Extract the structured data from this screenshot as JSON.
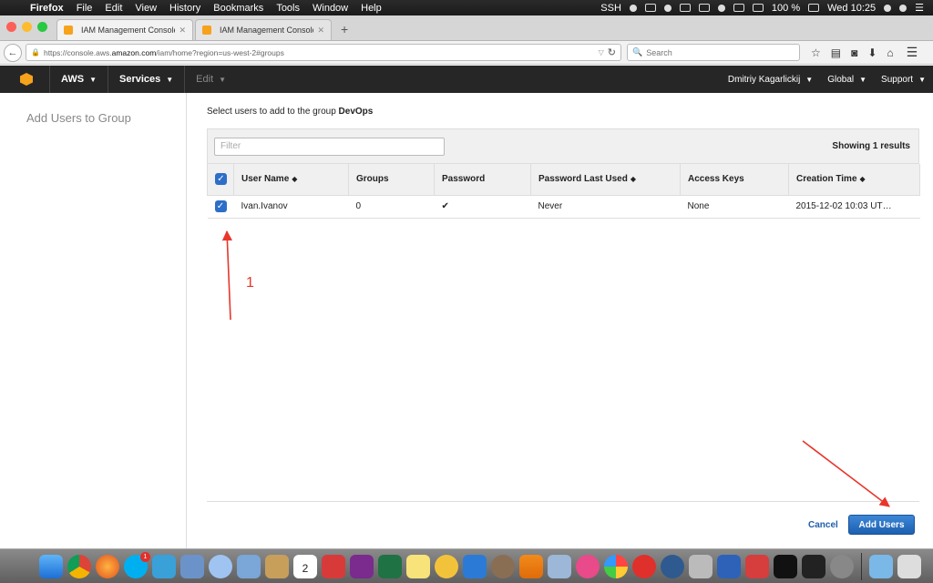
{
  "menubar": {
    "items": [
      "Firefox",
      "File",
      "Edit",
      "View",
      "History",
      "Bookmarks",
      "Tools",
      "Window",
      "Help"
    ],
    "right": {
      "ssh": "SSH",
      "battery": "100 %",
      "clock": "Wed 10:25"
    }
  },
  "browser": {
    "tabs": [
      {
        "title": "IAM Management Console"
      },
      {
        "title": "IAM Management Console"
      }
    ],
    "url_prefix": "https://console.aws.",
    "url_domain": "amazon.com",
    "url_suffix": "/iam/home?region=us-west-2#groups",
    "search_placeholder": "Search"
  },
  "aws": {
    "logo_text": "AWS",
    "services": "Services",
    "edit": "Edit",
    "user": "Dmitriy Kagarlickij",
    "region": "Global",
    "support": "Support"
  },
  "sidebar": {
    "title": "Add Users to Group"
  },
  "main": {
    "intro_prefix": "Select users to add to the group ",
    "group_name": "DevOps",
    "filter_placeholder": "Filter",
    "showing": "Showing 1 results",
    "columns": [
      "User Name",
      "Groups",
      "Password",
      "Password Last Used",
      "Access Keys",
      "Creation Time"
    ],
    "rows": [
      {
        "user": "Ivan.Ivanov",
        "groups": "0",
        "password": "✔",
        "last_used": "Never",
        "keys": "None",
        "created": "2015-12-02 10:03 UT…"
      }
    ],
    "cancel": "Cancel",
    "add_users": "Add Users"
  },
  "annotation": {
    "label": "1",
    "color": "#e8362b"
  },
  "dock": {
    "calendar_day": "2",
    "skype_badge": "1"
  }
}
